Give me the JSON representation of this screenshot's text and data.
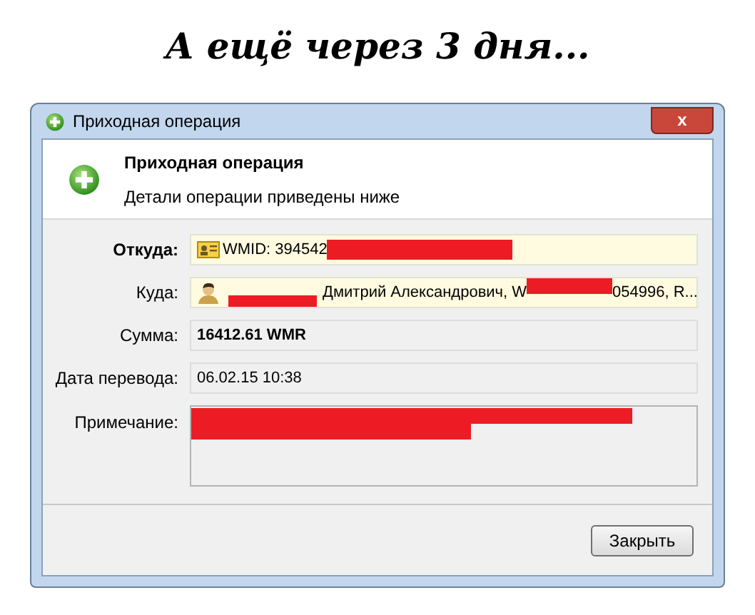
{
  "caption": "А ещё через 3 дня...",
  "window": {
    "title": "Приходная операция",
    "close": "x"
  },
  "header": {
    "title": "Приходная операция",
    "subtitle": "Детали операции приведены ниже"
  },
  "fields": [
    {
      "label": "Откуда:",
      "kind": "sender",
      "parts": [
        {
          "kind": "text",
          "text": "WMID: 394542"
        },
        {
          "kind": "redacted"
        }
      ]
    },
    {
      "label": "Куда:",
      "kind": "recipient",
      "parts": [
        {
          "kind": "redacted-low"
        },
        {
          "kind": "text",
          "text": "Дмитрий Александрович, W"
        },
        {
          "kind": "redacted-high"
        },
        {
          "kind": "text",
          "text": "054996, R..."
        }
      ]
    },
    {
      "label": "Сумма:",
      "kind": "amount",
      "parts": [
        {
          "kind": "text",
          "text": "16412.61 WMR"
        }
      ]
    },
    {
      "label": "Дата перевода:",
      "kind": "date",
      "parts": [
        {
          "kind": "text",
          "text": "06.02.15 10:38"
        }
      ]
    }
  ],
  "note": {
    "label": "Примечание:"
  },
  "buttons": [
    "Закрыть"
  ]
}
